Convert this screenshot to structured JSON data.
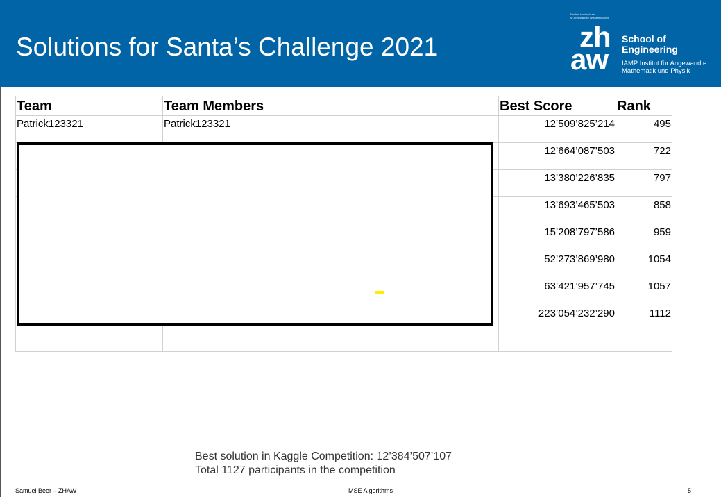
{
  "header": {
    "title": "Solutions for Santa’s Challenge 2021",
    "logo": {
      "small_text_1": "Zürcher Hochschule",
      "small_text_2": "für Angewandte Wissenschaften",
      "zh": "zh",
      "aw": "aw",
      "school_line1": "School of",
      "school_line2": "Engineering",
      "institute_line1": "IAMP Institut für Angewandte",
      "institute_line2": "Mathematik und Physik"
    },
    "background_color": "#0064a6"
  },
  "table": {
    "columns": [
      "Team",
      "Team Members",
      "Best Score",
      "Rank"
    ],
    "rows": [
      {
        "team": "Patrick123321",
        "members": "Patrick123321",
        "score": "12’509’825’214",
        "rank": "495"
      },
      {
        "team": "",
        "members": "",
        "score": "12’664’087’503",
        "rank": "722"
      },
      {
        "team": "",
        "members": "",
        "score": "13’380’226’835",
        "rank": "797"
      },
      {
        "team": "",
        "members": "",
        "score": "13’693’465’503",
        "rank": "858"
      },
      {
        "team": "",
        "members": "",
        "score": "15’208’797’586",
        "rank": "959"
      },
      {
        "team": "",
        "members": "",
        "score": "52’273’869’980",
        "rank": "1054"
      },
      {
        "team": "",
        "members": "",
        "score": "63’421’957’745",
        "rank": "1057"
      },
      {
        "team": "",
        "members": "",
        "score": "223’054’232’290",
        "rank": "1112"
      }
    ]
  },
  "notes": {
    "line1": "Best solution in Kaggle Competition: 12’384’507’107",
    "line2": "Total 1127 participants in the competition"
  },
  "footer": {
    "author": "Samuel Beer – ZHAW",
    "course": "MSE Algorithms",
    "page": "5"
  }
}
